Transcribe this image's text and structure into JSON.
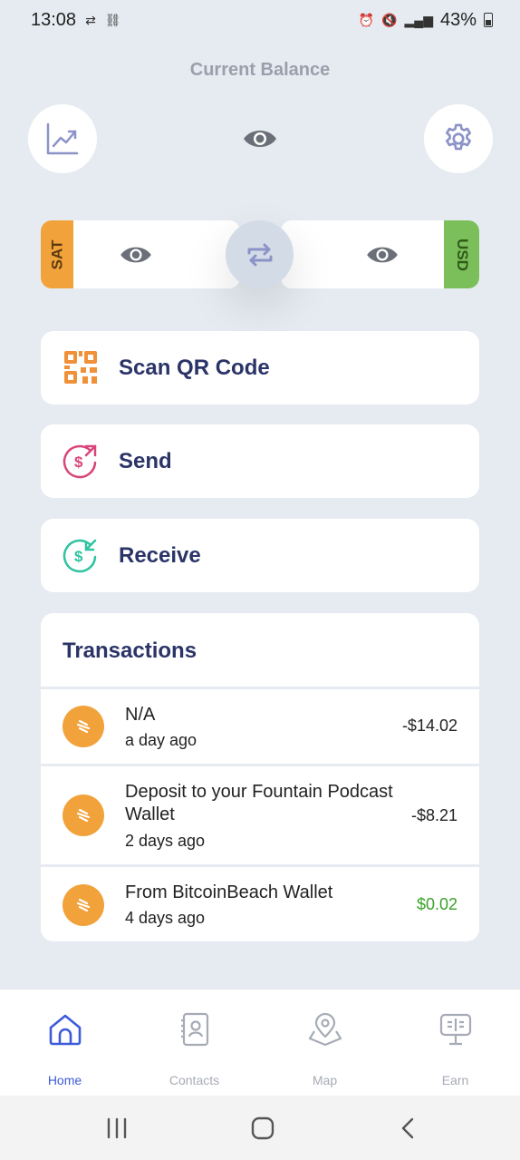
{
  "status_bar": {
    "time": "13:08",
    "battery": "43%"
  },
  "header": {
    "title": "Current Balance"
  },
  "currency": {
    "left_tag": "SAT",
    "right_tag": "USD"
  },
  "actions": [
    {
      "label": "Scan QR Code",
      "icon": "qr-code-icon"
    },
    {
      "label": "Send",
      "icon": "send-dollar-icon"
    },
    {
      "label": "Receive",
      "icon": "receive-dollar-icon"
    }
  ],
  "transactions": {
    "title": "Transactions",
    "items": [
      {
        "description": "N/A",
        "time": "a day ago",
        "amount": "-$14.02"
      },
      {
        "description": "Deposit to your Fountain Podcast Wallet",
        "time": "2 days ago",
        "amount": "-$8.21"
      },
      {
        "description": "From BitcoinBeach Wallet",
        "time": "4 days ago",
        "amount": "$0.02"
      }
    ]
  },
  "nav": {
    "items": [
      {
        "label": "Home",
        "icon": "home-icon"
      },
      {
        "label": "Contacts",
        "icon": "contacts-icon"
      },
      {
        "label": "Map",
        "icon": "map-icon"
      },
      {
        "label": "Earn",
        "icon": "earn-icon"
      }
    ]
  },
  "colors": {
    "background": "#e6ebf1",
    "primary_text": "#2b3467",
    "sat_orange": "#f1a23b",
    "usd_green": "#7bbf5a",
    "positive_amount": "#3aa12a",
    "nav_active": "#3d5bd8"
  }
}
